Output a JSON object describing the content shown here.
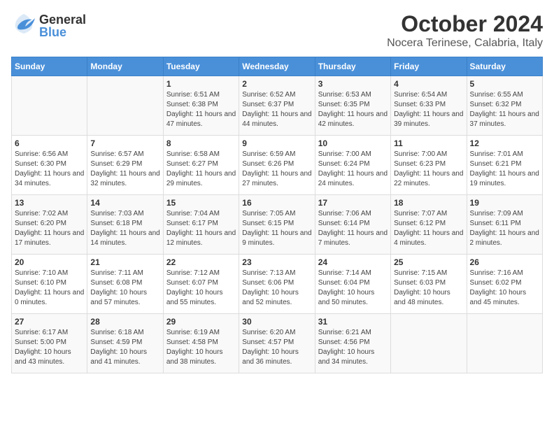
{
  "logo": {
    "general": "General",
    "blue": "Blue"
  },
  "title": "October 2024",
  "location": "Nocera Terinese, Calabria, Italy",
  "days_of_week": [
    "Sunday",
    "Monday",
    "Tuesday",
    "Wednesday",
    "Thursday",
    "Friday",
    "Saturday"
  ],
  "weeks": [
    [
      {
        "day": "",
        "info": ""
      },
      {
        "day": "",
        "info": ""
      },
      {
        "day": "1",
        "info": "Sunrise: 6:51 AM\nSunset: 6:38 PM\nDaylight: 11 hours and 47 minutes."
      },
      {
        "day": "2",
        "info": "Sunrise: 6:52 AM\nSunset: 6:37 PM\nDaylight: 11 hours and 44 minutes."
      },
      {
        "day": "3",
        "info": "Sunrise: 6:53 AM\nSunset: 6:35 PM\nDaylight: 11 hours and 42 minutes."
      },
      {
        "day": "4",
        "info": "Sunrise: 6:54 AM\nSunset: 6:33 PM\nDaylight: 11 hours and 39 minutes."
      },
      {
        "day": "5",
        "info": "Sunrise: 6:55 AM\nSunset: 6:32 PM\nDaylight: 11 hours and 37 minutes."
      }
    ],
    [
      {
        "day": "6",
        "info": "Sunrise: 6:56 AM\nSunset: 6:30 PM\nDaylight: 11 hours and 34 minutes."
      },
      {
        "day": "7",
        "info": "Sunrise: 6:57 AM\nSunset: 6:29 PM\nDaylight: 11 hours and 32 minutes."
      },
      {
        "day": "8",
        "info": "Sunrise: 6:58 AM\nSunset: 6:27 PM\nDaylight: 11 hours and 29 minutes."
      },
      {
        "day": "9",
        "info": "Sunrise: 6:59 AM\nSunset: 6:26 PM\nDaylight: 11 hours and 27 minutes."
      },
      {
        "day": "10",
        "info": "Sunrise: 7:00 AM\nSunset: 6:24 PM\nDaylight: 11 hours and 24 minutes."
      },
      {
        "day": "11",
        "info": "Sunrise: 7:00 AM\nSunset: 6:23 PM\nDaylight: 11 hours and 22 minutes."
      },
      {
        "day": "12",
        "info": "Sunrise: 7:01 AM\nSunset: 6:21 PM\nDaylight: 11 hours and 19 minutes."
      }
    ],
    [
      {
        "day": "13",
        "info": "Sunrise: 7:02 AM\nSunset: 6:20 PM\nDaylight: 11 hours and 17 minutes."
      },
      {
        "day": "14",
        "info": "Sunrise: 7:03 AM\nSunset: 6:18 PM\nDaylight: 11 hours and 14 minutes."
      },
      {
        "day": "15",
        "info": "Sunrise: 7:04 AM\nSunset: 6:17 PM\nDaylight: 11 hours and 12 minutes."
      },
      {
        "day": "16",
        "info": "Sunrise: 7:05 AM\nSunset: 6:15 PM\nDaylight: 11 hours and 9 minutes."
      },
      {
        "day": "17",
        "info": "Sunrise: 7:06 AM\nSunset: 6:14 PM\nDaylight: 11 hours and 7 minutes."
      },
      {
        "day": "18",
        "info": "Sunrise: 7:07 AM\nSunset: 6:12 PM\nDaylight: 11 hours and 4 minutes."
      },
      {
        "day": "19",
        "info": "Sunrise: 7:09 AM\nSunset: 6:11 PM\nDaylight: 11 hours and 2 minutes."
      }
    ],
    [
      {
        "day": "20",
        "info": "Sunrise: 7:10 AM\nSunset: 6:10 PM\nDaylight: 11 hours and 0 minutes."
      },
      {
        "day": "21",
        "info": "Sunrise: 7:11 AM\nSunset: 6:08 PM\nDaylight: 10 hours and 57 minutes."
      },
      {
        "day": "22",
        "info": "Sunrise: 7:12 AM\nSunset: 6:07 PM\nDaylight: 10 hours and 55 minutes."
      },
      {
        "day": "23",
        "info": "Sunrise: 7:13 AM\nSunset: 6:06 PM\nDaylight: 10 hours and 52 minutes."
      },
      {
        "day": "24",
        "info": "Sunrise: 7:14 AM\nSunset: 6:04 PM\nDaylight: 10 hours and 50 minutes."
      },
      {
        "day": "25",
        "info": "Sunrise: 7:15 AM\nSunset: 6:03 PM\nDaylight: 10 hours and 48 minutes."
      },
      {
        "day": "26",
        "info": "Sunrise: 7:16 AM\nSunset: 6:02 PM\nDaylight: 10 hours and 45 minutes."
      }
    ],
    [
      {
        "day": "27",
        "info": "Sunrise: 6:17 AM\nSunset: 5:00 PM\nDaylight: 10 hours and 43 minutes."
      },
      {
        "day": "28",
        "info": "Sunrise: 6:18 AM\nSunset: 4:59 PM\nDaylight: 10 hours and 41 minutes."
      },
      {
        "day": "29",
        "info": "Sunrise: 6:19 AM\nSunset: 4:58 PM\nDaylight: 10 hours and 38 minutes."
      },
      {
        "day": "30",
        "info": "Sunrise: 6:20 AM\nSunset: 4:57 PM\nDaylight: 10 hours and 36 minutes."
      },
      {
        "day": "31",
        "info": "Sunrise: 6:21 AM\nSunset: 4:56 PM\nDaylight: 10 hours and 34 minutes."
      },
      {
        "day": "",
        "info": ""
      },
      {
        "day": "",
        "info": ""
      }
    ]
  ]
}
